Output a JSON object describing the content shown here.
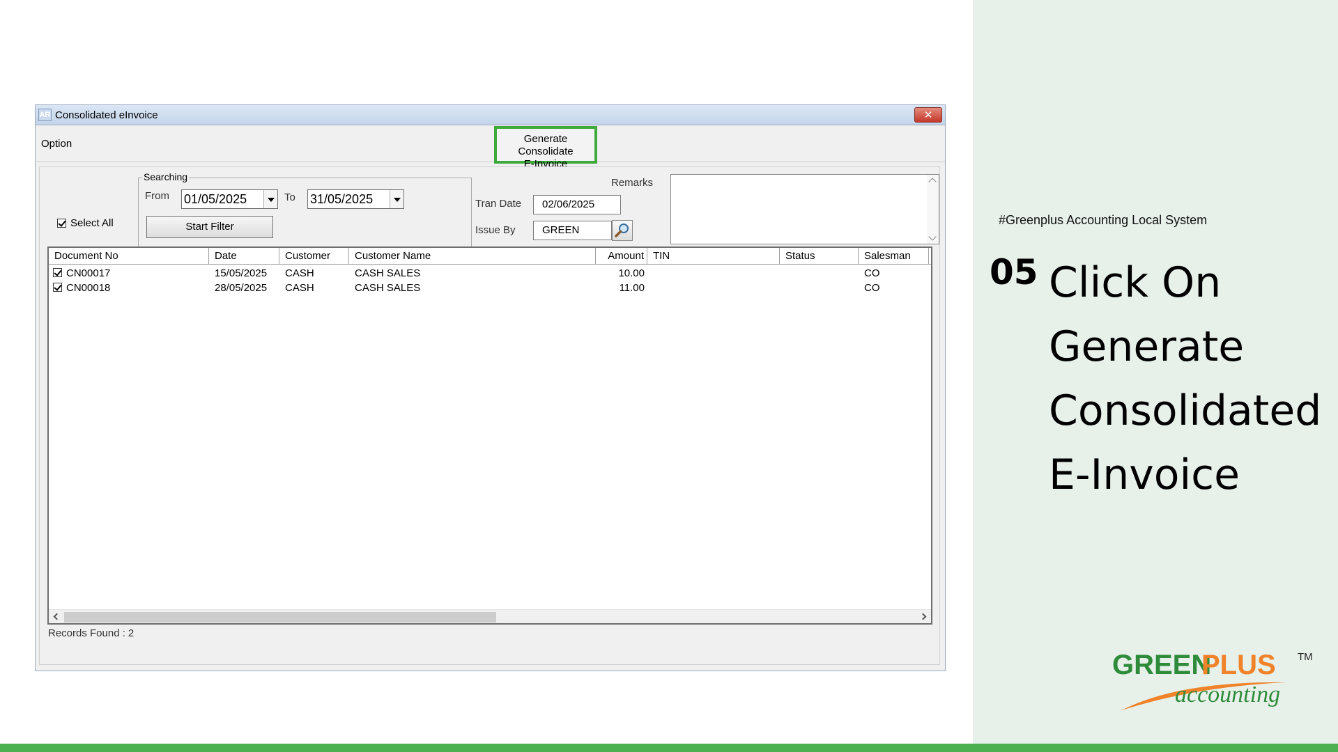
{
  "window": {
    "title": "Consolidated eInvoice",
    "app_icon_text": "AR",
    "close_label": "✕"
  },
  "toolbar": {
    "option_label": "Option",
    "generate_label_line1": "Generate Consolidate",
    "generate_label_line2": "E-Invoice"
  },
  "filters": {
    "select_all_label": "Select All",
    "select_all_checked": true,
    "searching_label": "Searching",
    "from_label": "From",
    "from_value": "01/05/2025",
    "to_label": "To",
    "to_value": "31/05/2025",
    "start_filter_label": "Start Filter",
    "tran_date_label": "Tran Date",
    "tran_date_value": "02/06/2025",
    "issue_by_label": "Issue By",
    "issue_by_value": "GREEN",
    "remarks_label": "Remarks",
    "remarks_value": ""
  },
  "grid": {
    "columns": [
      "Document No",
      "Date",
      "Customer",
      "Customer Name",
      "Amount",
      "TIN",
      "Status",
      "Salesman"
    ],
    "rows": [
      {
        "checked": true,
        "doc": "CN00017",
        "date": "15/05/2025",
        "customer": "CASH",
        "name": "CASH SALES",
        "amount": "10.00",
        "tin": "",
        "status": "",
        "salesman": "CO"
      },
      {
        "checked": true,
        "doc": "CN00018",
        "date": "28/05/2025",
        "customer": "CASH",
        "name": "CASH SALES",
        "amount": "11.00",
        "tin": "",
        "status": "",
        "salesman": "CO"
      }
    ]
  },
  "records": {
    "label": "Records Found :",
    "count": "2"
  },
  "slide": {
    "hashtag": "#Greenplus Accounting Local System",
    "step_number": "05",
    "step_lines": [
      "Click On",
      "Generate",
      "Consolidated",
      "E-Invoice"
    ]
  },
  "logo": {
    "brand_green": "GREEN",
    "brand_plus": "PLUS",
    "tagline": "accounting",
    "tm": "TM",
    "green_color": "#2e8b3a",
    "orange_color": "#f0822a"
  },
  "colors": {
    "accent_green": "#3daa3b",
    "panel_bg": "#e7f1ea",
    "bottom_bar": "#4caf50"
  }
}
